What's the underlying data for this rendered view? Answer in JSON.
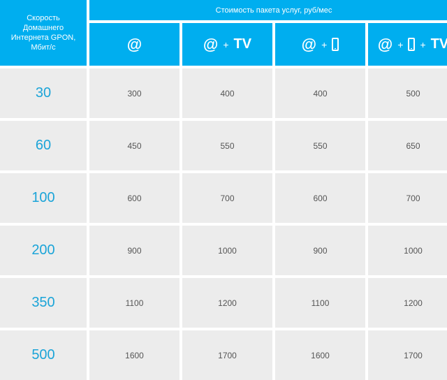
{
  "header": {
    "speed_label": "Скорость\nДомашнего\nИнтернета GPON,\nМбит/с",
    "price_label": "Стоимость пакета услуг, руб/мес",
    "packages": [
      {
        "at": "@",
        "plus": "",
        "tv": ""
      },
      {
        "at": "@",
        "plus": "+",
        "tv": "TV"
      },
      {
        "at": "@",
        "plus": "+",
        "tv": ""
      },
      {
        "at": "@",
        "plus": "+",
        "plus2": "+",
        "tv": "TV"
      }
    ]
  },
  "rows": [
    {
      "speed": "30",
      "prices": [
        "300",
        "400",
        "400",
        "500"
      ]
    },
    {
      "speed": "60",
      "prices": [
        "450",
        "550",
        "550",
        "650"
      ]
    },
    {
      "speed": "100",
      "prices": [
        "600",
        "700",
        "600",
        "700"
      ]
    },
    {
      "speed": "200",
      "prices": [
        "900",
        "1000",
        "900",
        "1000"
      ]
    },
    {
      "speed": "350",
      "prices": [
        "1100",
        "1200",
        "1100",
        "1200"
      ]
    },
    {
      "speed": "500",
      "prices": [
        "1600",
        "1700",
        "1600",
        "1700"
      ]
    }
  ],
  "icons": {
    "phone": "mobile-phone-icon"
  },
  "colors": {
    "header_bg": "#00aeef",
    "cell_bg": "#ececec",
    "speed_text": "#1ba4d8",
    "price_text": "#555555"
  }
}
